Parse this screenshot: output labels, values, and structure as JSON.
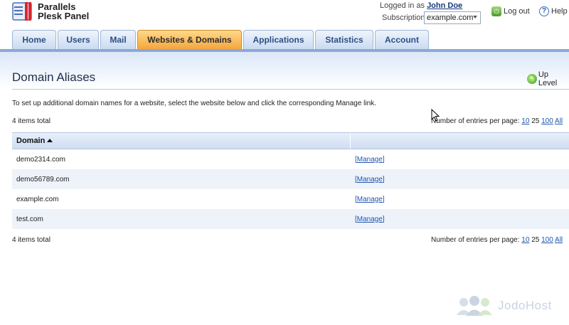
{
  "brand": {
    "line1": "Parallels",
    "line2": "Plesk Panel"
  },
  "session": {
    "logged_in_label": "Logged in as",
    "user_name": "John Doe",
    "subscription_label": "Subscription",
    "subscription_value": "example.com",
    "logout_label": "Log out",
    "help_label": "Help"
  },
  "tabs": [
    {
      "label": "Home"
    },
    {
      "label": "Users"
    },
    {
      "label": "Mail"
    },
    {
      "label": "Websites & Domains",
      "active": true
    },
    {
      "label": "Applications"
    },
    {
      "label": "Statistics"
    },
    {
      "label": "Account"
    }
  ],
  "page": {
    "title": "Domain Aliases",
    "up_level_label": "Up Level",
    "description": "To set up additional domain names for a website, select the website below and click the corresponding Manage link."
  },
  "list": {
    "total_label": "4 items total",
    "per_page_label": "Number of entries per page:",
    "per_page_options": [
      "10",
      "25",
      "100",
      "All"
    ],
    "per_page_selected": "25",
    "column_domain": "Domain",
    "rows": [
      {
        "domain": "demo2314.com",
        "action": "[Manage]"
      },
      {
        "domain": "demo56789.com",
        "action": "[Manage]"
      },
      {
        "domain": "example.com",
        "action": "[Manage]"
      },
      {
        "domain": "test.com",
        "action": "[Manage]"
      }
    ]
  },
  "watermark": {
    "text": "JodoHost"
  },
  "colors": {
    "active_tab": "#f4a43a",
    "tab": "#c9daf0",
    "link": "#1f56b0",
    "row_alt": "#eef2f9"
  }
}
